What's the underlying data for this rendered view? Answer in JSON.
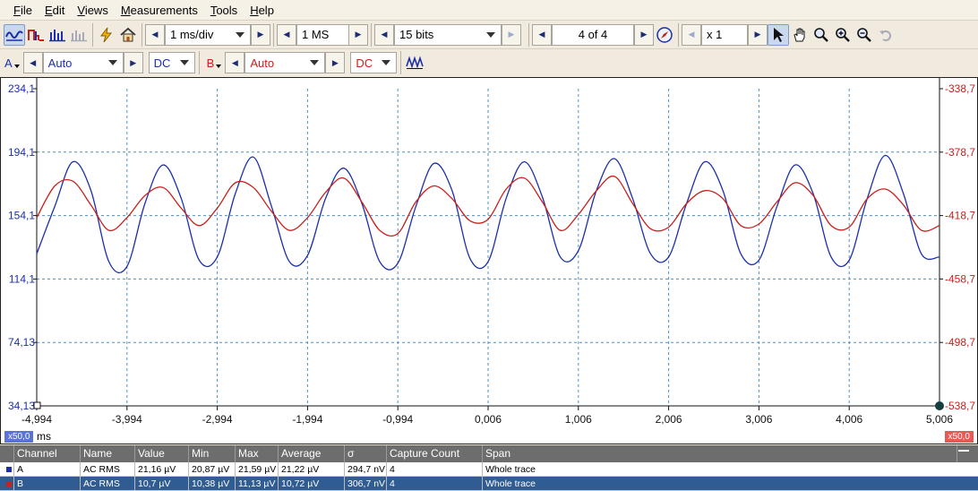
{
  "menu": {
    "items": [
      {
        "key": "F",
        "rest": "ile"
      },
      {
        "key": "E",
        "rest": "dit"
      },
      {
        "key": "V",
        "rest": "iews"
      },
      {
        "key": "M",
        "rest": "easurements"
      },
      {
        "key": "T",
        "rest": "ools"
      },
      {
        "key": "H",
        "rest": "elp"
      }
    ]
  },
  "toolbar": {
    "timebase": "1 ms/div",
    "samples": "1 MS",
    "resolution": "15 bits",
    "buffer": "4 of 4",
    "zoom": "x 1"
  },
  "channels": {
    "a": {
      "label": "A",
      "range": "Auto",
      "coupling": "DC",
      "color": "#1c2fa8"
    },
    "b": {
      "label": "B",
      "range": "Auto",
      "coupling": "DC",
      "color": "#c8201a"
    }
  },
  "scope": {
    "left_axis_ticks": [
      "234,1",
      "194,1",
      "154,1",
      "114,1",
      "74,13",
      "34,13"
    ],
    "right_axis_ticks": [
      "-338,7",
      "-378,7",
      "-418,7",
      "-458,7",
      "-498,7",
      "-538,7"
    ],
    "x_axis_ticks": [
      "-4,994",
      "-3,994",
      "-2,994",
      "-1,994",
      "-0,994",
      "0,006",
      "1,006",
      "2,006",
      "3,006",
      "4,006",
      "5,006"
    ],
    "x_unit": "ms",
    "zoom_left": "x50,0",
    "zoom_right": "x50,0",
    "grid": true,
    "chart_data": {
      "type": "line",
      "xlim": [
        -4.994,
        5.006
      ],
      "series": [
        {
          "name": "A",
          "color": "#1c2fa8",
          "axis": "left",
          "ylim": [
            34.13,
            234.1
          ],
          "x": [
            -4.994,
            -4.794,
            -4.594,
            -4.394,
            -4.194,
            -3.994,
            -3.794,
            -3.594,
            -3.394,
            -3.194,
            -2.994,
            -2.794,
            -2.594,
            -2.394,
            -2.194,
            -1.994,
            -1.794,
            -1.594,
            -1.394,
            -1.194,
            -0.994,
            -0.794,
            -0.594,
            -0.394,
            -0.194,
            0.006,
            0.206,
            0.406,
            0.606,
            0.806,
            1.006,
            1.206,
            1.406,
            1.606,
            1.806,
            2.006,
            2.206,
            2.406,
            2.606,
            2.806,
            3.006,
            3.206,
            3.406,
            3.606,
            3.806,
            4.006,
            4.206,
            4.406,
            4.606,
            4.806,
            5.006
          ],
          "y": [
            130,
            160,
            188,
            170,
            125,
            122,
            162,
            186,
            165,
            126,
            128,
            168,
            191,
            160,
            125,
            129,
            165,
            184,
            162,
            125,
            124,
            160,
            187,
            170,
            127,
            125,
            165,
            188,
            166,
            128,
            132,
            170,
            190,
            165,
            130,
            128,
            162,
            188,
            170,
            130,
            126,
            160,
            186,
            168,
            128,
            126,
            165,
            192,
            168,
            130,
            128
          ]
        },
        {
          "name": "B",
          "color": "#c8201a",
          "axis": "right",
          "ylim": [
            -538.7,
            -338.7
          ],
          "x": [
            -4.994,
            -4.794,
            -4.594,
            -4.394,
            -4.194,
            -3.994,
            -3.794,
            -3.594,
            -3.394,
            -3.194,
            -2.994,
            -2.794,
            -2.594,
            -2.394,
            -2.194,
            -1.994,
            -1.794,
            -1.594,
            -1.394,
            -1.194,
            -0.994,
            -0.794,
            -0.594,
            -0.394,
            -0.194,
            0.006,
            0.206,
            0.406,
            0.606,
            0.806,
            1.006,
            1.206,
            1.406,
            1.606,
            1.806,
            2.006,
            2.206,
            2.406,
            2.606,
            2.806,
            3.006,
            3.206,
            3.406,
            3.606,
            3.806,
            4.006,
            4.206,
            4.406,
            4.606,
            4.806,
            5.006
          ],
          "y": [
            -420,
            -400,
            -397,
            -412,
            -428,
            -420,
            -406,
            -401,
            -414,
            -425,
            -414,
            -398,
            -401,
            -416,
            -428,
            -420,
            -404,
            -395,
            -410,
            -428,
            -430,
            -410,
            -400,
            -408,
            -422,
            -421,
            -402,
            -395,
            -410,
            -428,
            -418,
            -403,
            -394,
            -411,
            -427,
            -426,
            -411,
            -403,
            -408,
            -425,
            -424,
            -410,
            -398,
            -406,
            -425,
            -426,
            -408,
            -402,
            -412,
            -428,
            -425
          ]
        }
      ]
    }
  },
  "measurements": {
    "headers": [
      "Channel",
      "Name",
      "Value",
      "Min",
      "Max",
      "Average",
      "σ",
      "Capture Count",
      "Span"
    ],
    "rows": [
      {
        "channel": "A",
        "name": "AC RMS",
        "value": "21,16 µV",
        "min": "20,87 µV",
        "max": "21,59 µV",
        "average": "21,22 µV",
        "sigma": "294,7 nV",
        "count": "4",
        "span": "Whole trace"
      },
      {
        "channel": "B",
        "name": "AC RMS",
        "value": "10,7 µV",
        "min": "10,38 µV",
        "max": "11,13 µV",
        "average": "10,72 µV",
        "sigma": "306,7 nV",
        "count": "4",
        "span": "Whole trace"
      }
    ]
  }
}
